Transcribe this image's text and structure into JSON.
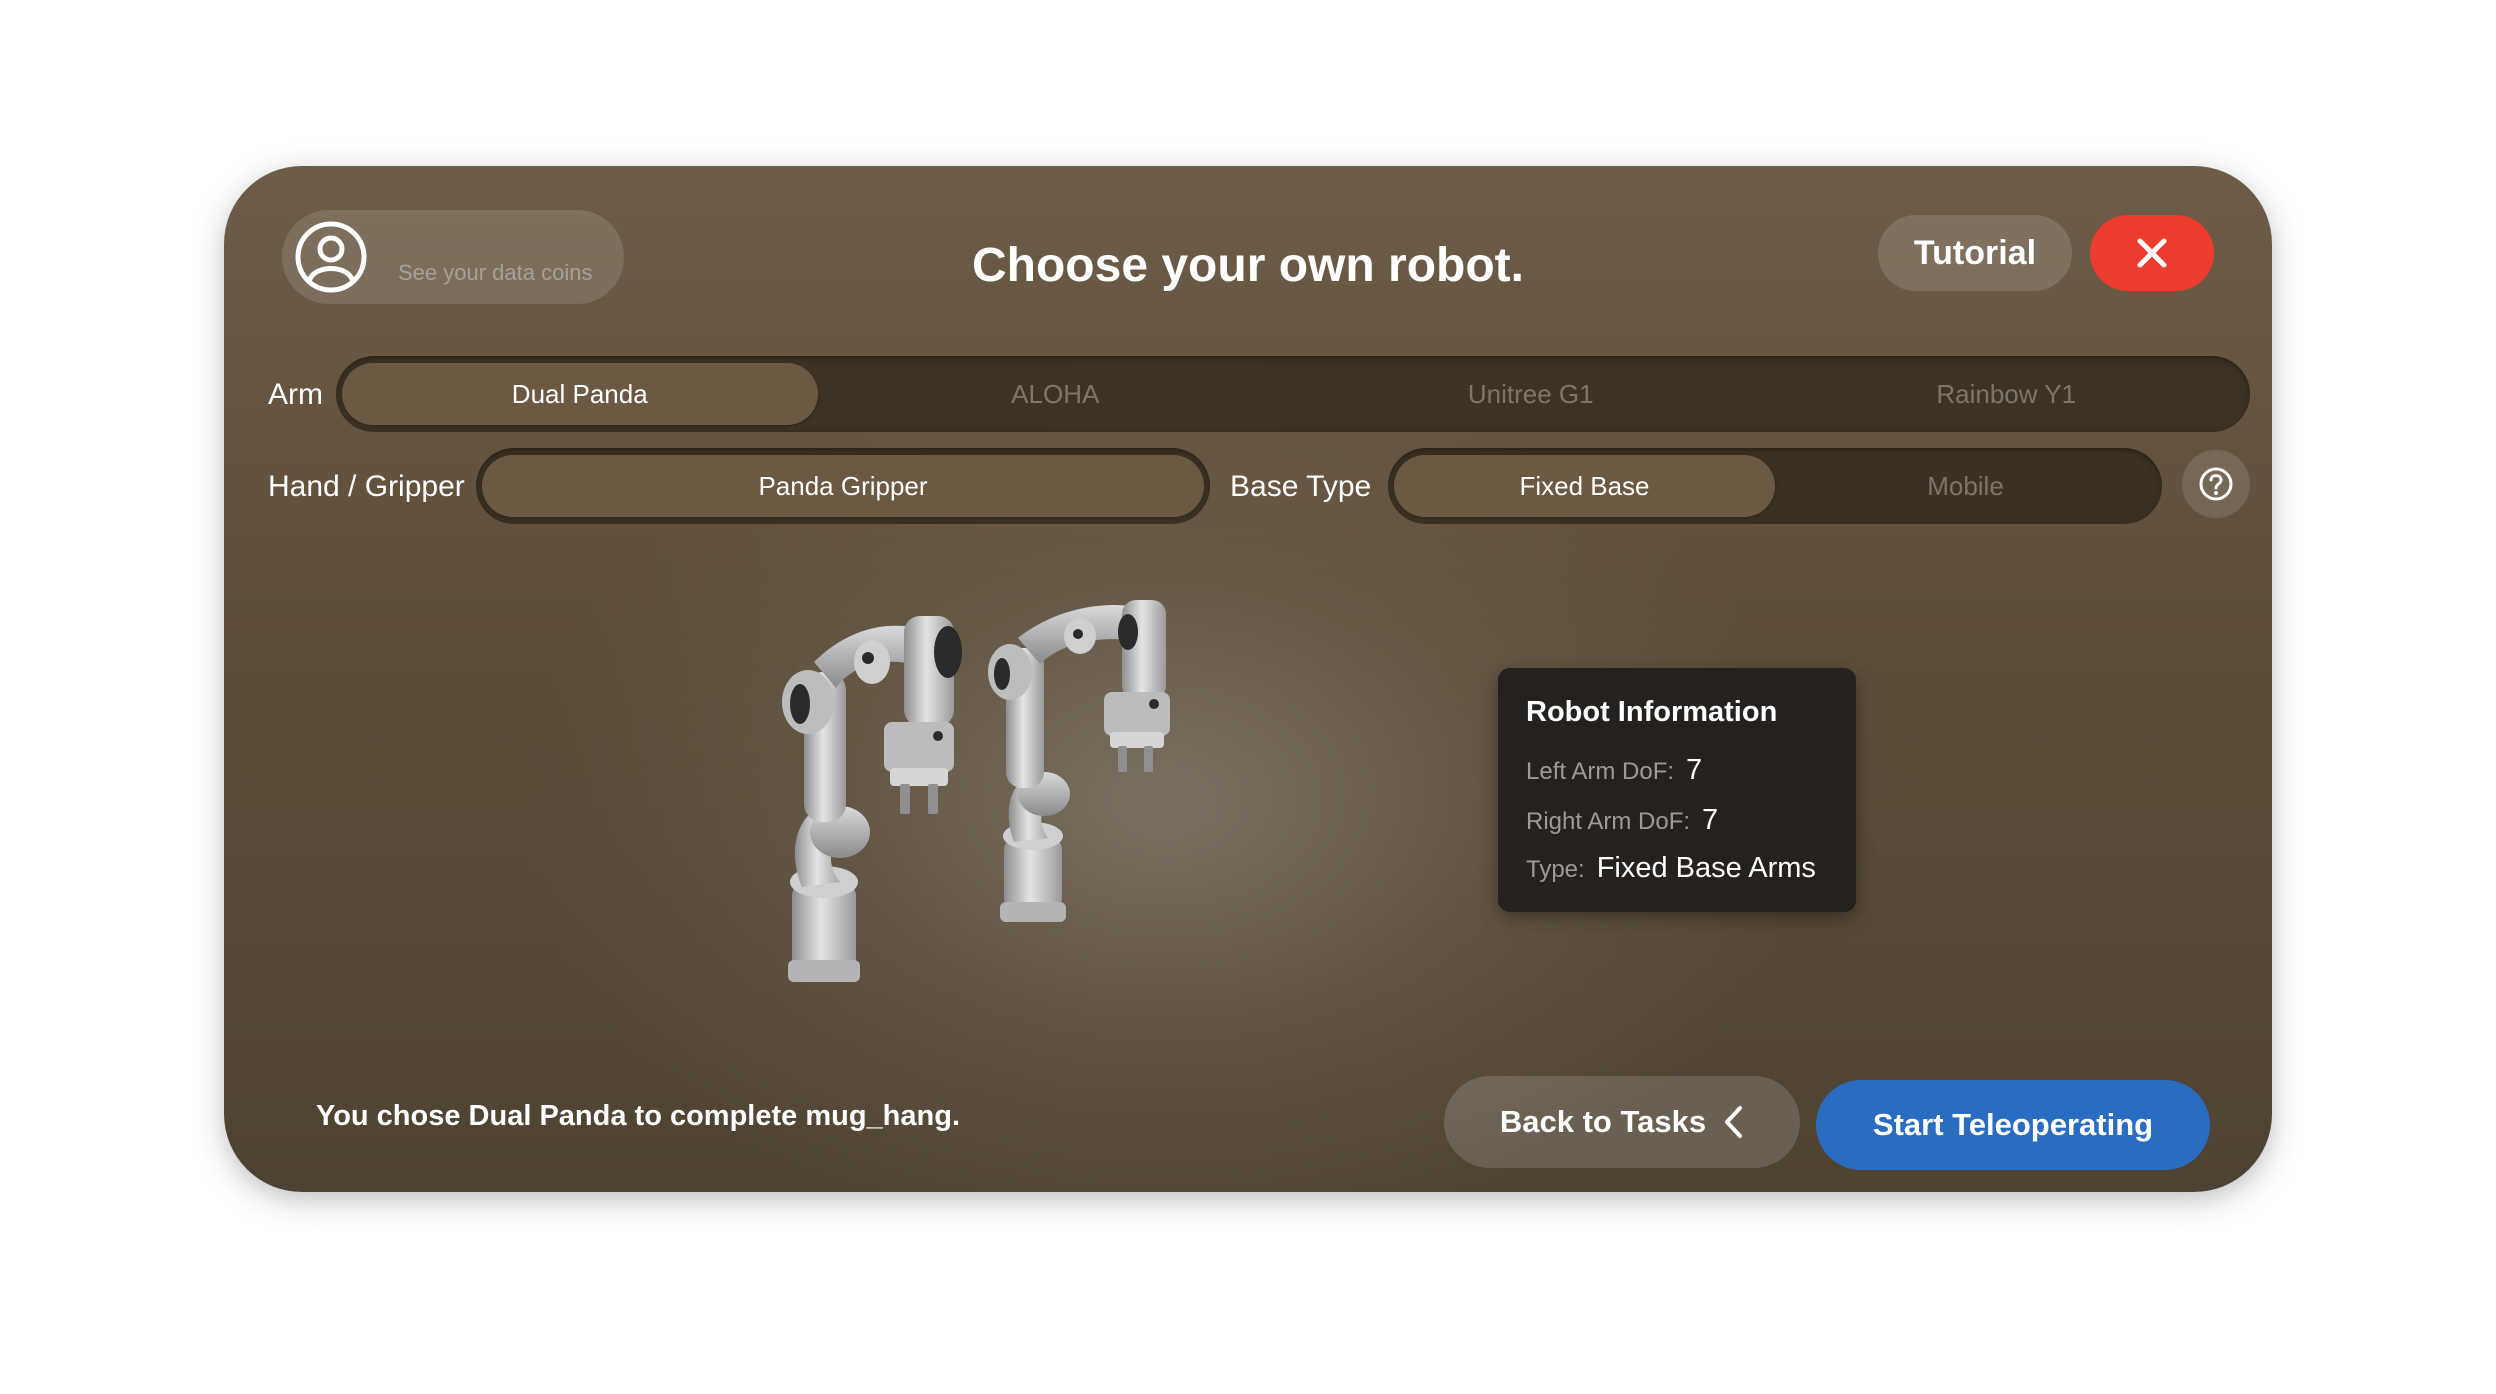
{
  "header": {
    "profile_hint": "See your data coins",
    "title": "Choose your own robot.",
    "tutorial_label": "Tutorial"
  },
  "arm": {
    "label": "Arm",
    "options": [
      "Dual Panda",
      "ALOHA",
      "Unitree G1",
      "Rainbow Y1"
    ],
    "selected": "Dual Panda"
  },
  "gripper": {
    "label": "Hand / Gripper",
    "options": [
      "Panda Gripper"
    ],
    "selected": "Panda Gripper"
  },
  "base": {
    "label": "Base Type",
    "options": [
      "Fixed Base",
      "Mobile"
    ],
    "selected": "Fixed Base"
  },
  "robot_info": {
    "title": "Robot Information",
    "left_arm_label": "Left Arm DoF:",
    "left_arm_value": "7",
    "right_arm_label": "Right Arm DoF:",
    "right_arm_value": "7",
    "type_label": "Type:",
    "type_value": "Fixed Base Arms"
  },
  "footer": {
    "status": "You chose Dual Panda to complete mug_hang.",
    "back_label": "Back to Tasks",
    "start_label": "Start Teleoperating"
  },
  "colors": {
    "close": "#ec3c2f",
    "primary": "#2a6cc0"
  },
  "icons": [
    "user-avatar-icon",
    "close-icon",
    "help-icon",
    "chevron-left-icon"
  ]
}
